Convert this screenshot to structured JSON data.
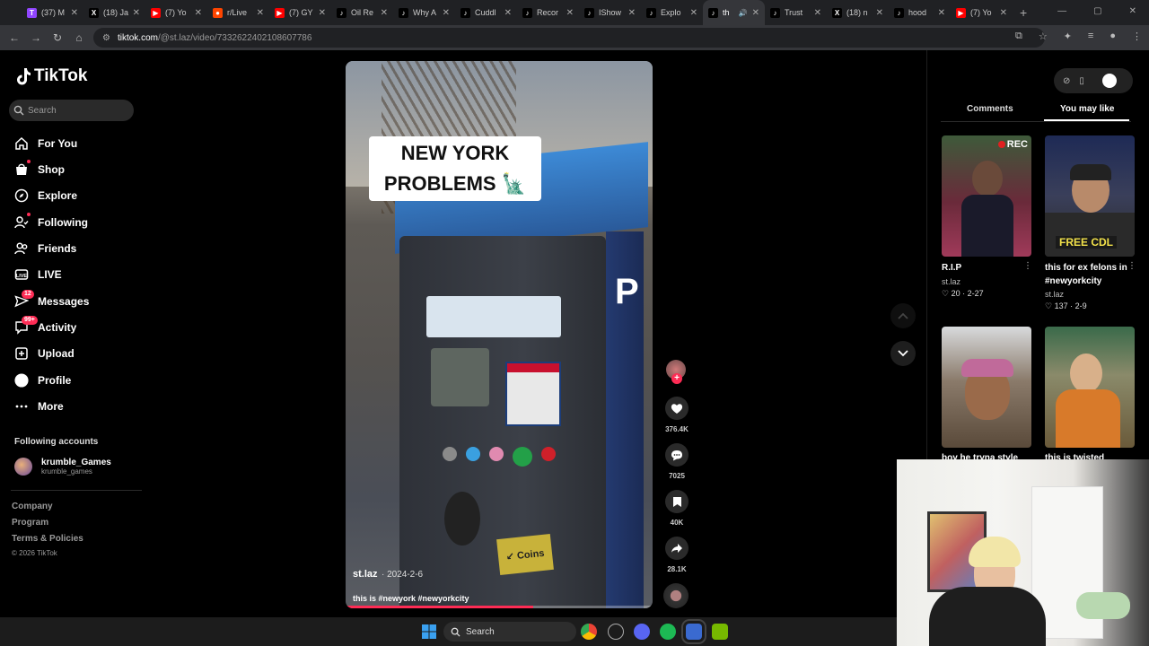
{
  "browser": {
    "tabs": [
      {
        "label": "(37) M",
        "favicon": "twitch",
        "color": "#9146ff"
      },
      {
        "label": "(18) Ja",
        "favicon": "x",
        "color": "#000000"
      },
      {
        "label": "(7) Yo",
        "favicon": "youtube",
        "color": "#ff0000"
      },
      {
        "label": "r/Live",
        "favicon": "reddit",
        "color": "#ff4500"
      },
      {
        "label": "(7) GY",
        "favicon": "youtube",
        "color": "#ff0000"
      },
      {
        "label": "Oil Re",
        "favicon": "tiktok",
        "color": "#000000"
      },
      {
        "label": "Why A",
        "favicon": "tiktok",
        "color": "#000000"
      },
      {
        "label": "Cuddl",
        "favicon": "tiktok",
        "color": "#000000"
      },
      {
        "label": "Recor",
        "favicon": "tiktok",
        "color": "#000000"
      },
      {
        "label": "IShow",
        "favicon": "tiktok",
        "color": "#000000"
      },
      {
        "label": "Explo",
        "favicon": "tiktok",
        "color": "#000000"
      },
      {
        "label": "th",
        "favicon": "tiktok",
        "color": "#000000",
        "active": true
      },
      {
        "label": "Trust",
        "favicon": "tiktok",
        "color": "#000000"
      },
      {
        "label": "(18) n",
        "favicon": "x",
        "color": "#000000"
      },
      {
        "label": "hood",
        "favicon": "tiktok",
        "color": "#000000"
      },
      {
        "label": "(7) Yo",
        "favicon": "youtube",
        "color": "#ff0000"
      }
    ],
    "url_host": "tiktok.com",
    "url_path": "/@st.laz/video/7332622402108607786"
  },
  "sidebar": {
    "logo": "TikTok",
    "search_placeholder": "Search",
    "nav": [
      {
        "label": "For You",
        "icon": "home-icon"
      },
      {
        "label": "Shop",
        "icon": "shop-icon"
      },
      {
        "label": "Explore",
        "icon": "compass-icon"
      },
      {
        "label": "Following",
        "icon": "following-icon"
      },
      {
        "label": "Friends",
        "icon": "friends-icon"
      },
      {
        "label": "LIVE",
        "icon": "live-icon"
      },
      {
        "label": "Messages",
        "icon": "messages-icon",
        "badge": "12"
      },
      {
        "label": "Activity",
        "icon": "activity-icon",
        "badge": "99+"
      },
      {
        "label": "Upload",
        "icon": "upload-icon"
      },
      {
        "label": "Profile",
        "icon": "profile-icon"
      },
      {
        "label": "More",
        "icon": "more-icon"
      }
    ],
    "following_title": "Following accounts",
    "account": {
      "name": "krumble_Games",
      "handle": "krumble_games"
    },
    "footer": [
      "Company",
      "Program",
      "Terms & Policies"
    ],
    "copyright": "© 2026 TikTok"
  },
  "video": {
    "overlay_line1": "NEW YORK",
    "overlay_line2": "PROBLEMS 🗽",
    "author": "st.laz",
    "date": "· 2024-2-6",
    "description": "this is #newyork #newyorkcity",
    "meter_label": "P",
    "coins_label": "↙ Coins",
    "progress": 0.61
  },
  "actions": {
    "likes": "376.4K",
    "comments": "7025",
    "saves": "40K",
    "shares": "28.1K"
  },
  "right_panel": {
    "tab_comments": "Comments",
    "tab_you_may_like": "You may like",
    "cards": [
      {
        "title": "R.I.P",
        "author": "st.laz",
        "likes": "20",
        "date": "2-27",
        "overlay": "REC"
      },
      {
        "title": "this for ex felons in #newyorkcity",
        "author": "st.laz",
        "likes": "137",
        "date": "2-9",
        "overlay": "FREE CDL"
      },
      {
        "title": "boy he tryna style",
        "author": "",
        "likes": "",
        "date": ""
      },
      {
        "title": "this is twisted",
        "author": "",
        "likes": "",
        "date": ""
      }
    ]
  },
  "taskbar": {
    "search_label": "Search"
  }
}
